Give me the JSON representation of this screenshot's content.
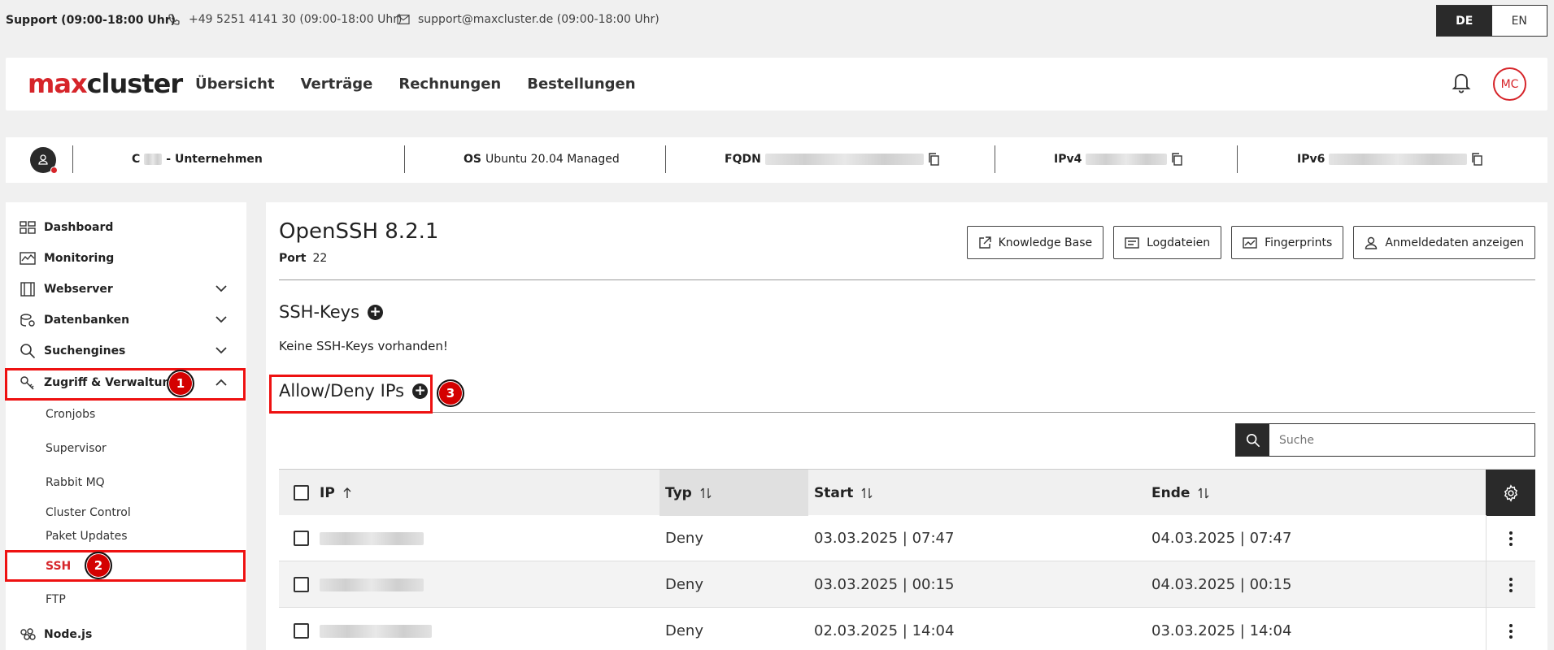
{
  "topbar": {
    "support_label": "Support (09:00-18:00 Uhr)",
    "phone": "+49 5251 4141 30 (09:00-18:00 Uhr)",
    "email": "support@maxcluster.de (09:00-18:00 Uhr)",
    "lang_de": "DE",
    "lang_en": "EN"
  },
  "nav": {
    "logo_max": "max",
    "logo_cluster": "cluster",
    "items": [
      "Übersicht",
      "Verträge",
      "Rechnungen",
      "Bestellungen"
    ],
    "avatar_initials": "MC"
  },
  "server": {
    "name_prefix": "C",
    "name_suffix": "-  Unternehmen",
    "os_label": "OS",
    "os_value": "Ubuntu 20.04 Managed",
    "fqdn_label": "FQDN",
    "ipv4_label": "IPv4",
    "ipv6_label": "IPv6"
  },
  "sidebar": {
    "dashboard": "Dashboard",
    "monitoring": "Monitoring",
    "webserver": "Webserver",
    "datenbanken": "Datenbanken",
    "suchengines": "Suchengines",
    "zugriff": "Zugriff & Verwaltung",
    "sub": [
      "Cronjobs",
      "Supervisor",
      "Rabbit MQ",
      "Cluster Control",
      "Paket Updates",
      "SSH",
      "FTP"
    ],
    "nodejs": "Node.js"
  },
  "badges": [
    "1",
    "2",
    "3"
  ],
  "main": {
    "title": "OpenSSH 8.2.1",
    "port_label": "Port",
    "port_value": "22",
    "buttons": [
      "Knowledge Base",
      "Logdateien",
      "Fingerprints",
      "Anmeldedaten anzeigen"
    ],
    "ssh_keys_title": "SSH-Keys",
    "ssh_keys_empty": "Keine SSH-Keys vorhanden!",
    "allow_deny_title": "Allow/Deny IPs",
    "search_placeholder": "Suche"
  },
  "table": {
    "headers": {
      "ip": "IP",
      "typ": "Typ",
      "start": "Start",
      "ende": "Ende"
    },
    "rows": [
      {
        "typ": "Deny",
        "start": "03.03.2025 | 07:47",
        "ende": "04.03.2025 | 07:47"
      },
      {
        "typ": "Deny",
        "start": "03.03.2025 | 00:15",
        "ende": "04.03.2025 | 00:15"
      },
      {
        "typ": "Deny",
        "start": "02.03.2025 | 14:04",
        "ende": "03.03.2025 | 14:04"
      }
    ]
  },
  "colors": {
    "brand_red": "#d6252a",
    "dark": "#2a2a2a",
    "annotation_red": "#e11111"
  }
}
